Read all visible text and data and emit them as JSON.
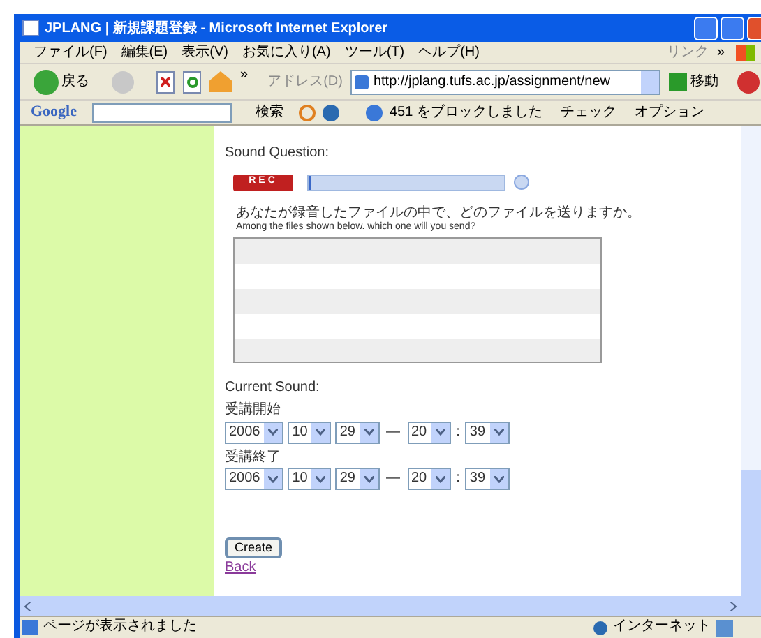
{
  "window": {
    "title": "JPLANG | 新規課題登録 - Microsoft Internet Explorer"
  },
  "menu": {
    "items": [
      "ファイル(F)",
      "編集(E)",
      "表示(V)",
      "お気に入り(A)",
      "ツール(T)",
      "ヘルプ(H)"
    ],
    "links": "リンク",
    "chevron": "»"
  },
  "toolbar": {
    "back": "戻る",
    "chevron": "»",
    "address_label": "アドレス(D)",
    "url": "http://jplang.tufs.ac.jp/assignment/new",
    "go": "移動"
  },
  "google_bar": {
    "logo": "Google",
    "search": "検索",
    "blocked": "451 をブロックしました",
    "check": "チェック",
    "options": "オプション"
  },
  "content": {
    "sound_question": "Sound Question:",
    "rec_button": "REC",
    "recording_progress": {
      "level": 0.01
    },
    "prompt_ja": "あなたが録音したファイルの中で、どのファイルを送りますか。",
    "prompt_en": "Among the files shown below. which one will you send?",
    "current_sound": "Current Sound:",
    "date_rows": [
      {
        "label": "受講開始",
        "year": "2006",
        "month": "10",
        "day": "29",
        "dash": "—",
        "hour": "20",
        "colon": ":",
        "minute": "39"
      },
      {
        "label": "受講終了",
        "year": "2006",
        "month": "10",
        "day": "29",
        "dash": "—",
        "hour": "20",
        "colon": ":",
        "minute": "39"
      }
    ],
    "create_button": "Create",
    "back_link": "Back"
  },
  "status_bar": {
    "message": "ページが表示されました",
    "zone": "インターネット"
  }
}
